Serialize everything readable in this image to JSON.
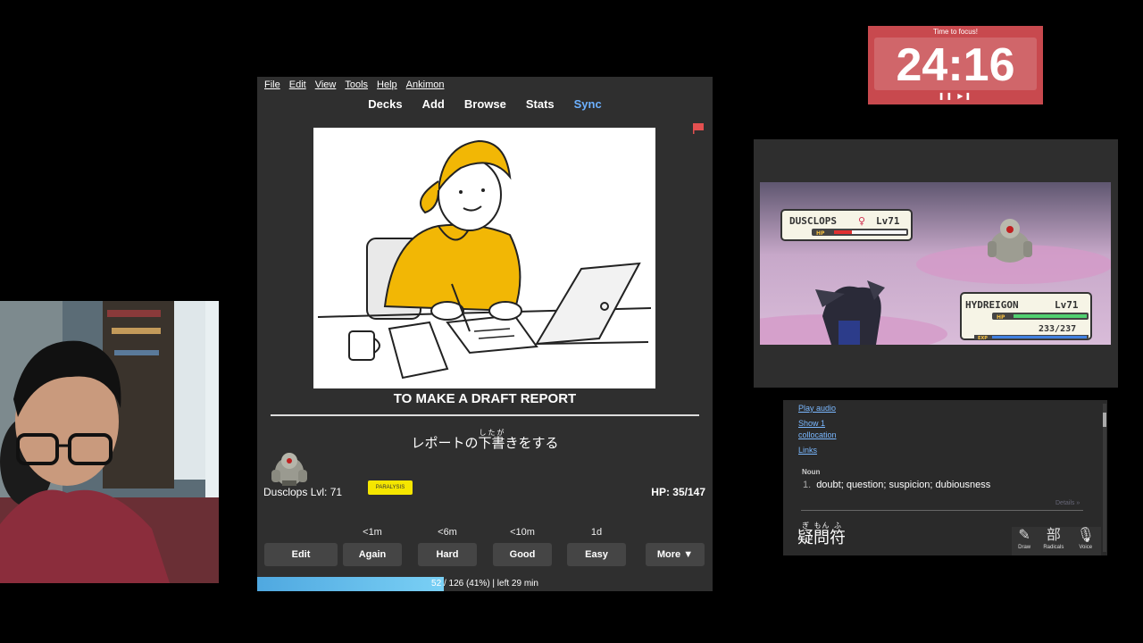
{
  "anki": {
    "menu": [
      "File",
      "Edit",
      "View",
      "Tools",
      "Help",
      "Ankimon"
    ],
    "nav": {
      "decks": "Decks",
      "add": "Add",
      "browse": "Browse",
      "stats": "Stats",
      "sync": "Sync"
    },
    "card": {
      "front": "TO MAKE A DRAFT REPORT",
      "back_before": "レポートの",
      "back_ruby_base": "下書",
      "back_ruby_reading": "したが",
      "back_after": "きをする"
    },
    "pokemon": {
      "label": "Dusclops Lvl: 71",
      "status": "PARALYSIS",
      "hp": "HP: 35/147"
    },
    "buttons": {
      "edit": "Edit",
      "again": {
        "time": "<1m",
        "label": "Again"
      },
      "hard": {
        "time": "<6m",
        "label": "Hard"
      },
      "good": {
        "time": "<10m",
        "label": "Good"
      },
      "easy": {
        "time": "1d",
        "label": "Easy"
      },
      "more": "More ▼"
    },
    "progress": {
      "text": "52 / 126 (41%) | left 29 min",
      "fraction": 0.41
    }
  },
  "timer": {
    "title": "Time to focus!",
    "time": "24:16",
    "controls": "❚❚ ▶❚"
  },
  "game": {
    "enemy": {
      "name": "DUSCLOPS",
      "gender": "♀",
      "level": "Lv71"
    },
    "player": {
      "name": "HYDREIGON",
      "level": "Lv71",
      "hp": "233/237"
    },
    "hp_label": "HP",
    "exp_label": "EXP"
  },
  "dict": {
    "play_audio": "Play audio",
    "show_collocation_1": "Show 1",
    "show_collocation_2": "collocation",
    "links": "Links",
    "pos": "Noun",
    "meaning_num": "1.",
    "meaning": "doubt; question; suspicion; dubiousness",
    "details": "Details »",
    "word_parts": [
      {
        "base": "疑",
        "rt": "ぎ"
      },
      {
        "base": "問",
        "rt": "もん"
      },
      {
        "base": "符",
        "rt": "ふ"
      }
    ],
    "tools": [
      {
        "icon": "✎",
        "label": "Draw"
      },
      {
        "icon": "部",
        "label": "Radicals"
      },
      {
        "icon": "🎙",
        "label": "Voice"
      }
    ]
  },
  "colors": {
    "timer_red": "#c8494e",
    "sync_blue": "#6cb0ff",
    "status_yellow": "#f5e600",
    "progress_blue": "#4fa8e0"
  }
}
